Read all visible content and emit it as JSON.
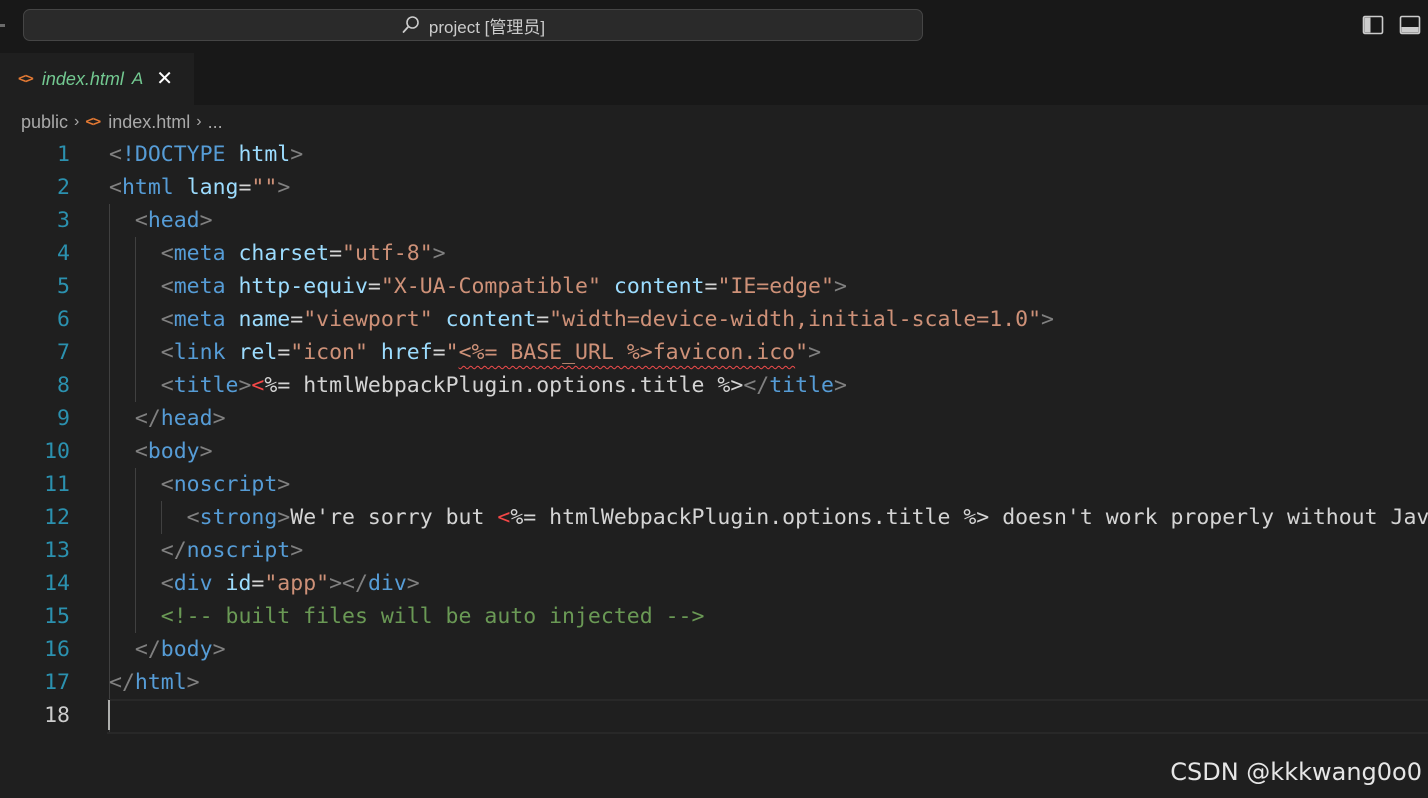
{
  "window": {
    "search_text": "project [管理员]"
  },
  "tab": {
    "filename": "index.html",
    "badge": "A",
    "close": "✕",
    "icon": "<>"
  },
  "breadcrumb": {
    "items": [
      "public",
      "index.html",
      "..."
    ],
    "separator": "›"
  },
  "editor": {
    "active_line": 18,
    "lines": [
      {
        "n": "1",
        "indent": 0,
        "tokens": [
          [
            "punc",
            "<"
          ],
          [
            "tag",
            "!DOCTYPE "
          ],
          [
            "attr",
            "html"
          ],
          [
            "punc",
            ">"
          ]
        ]
      },
      {
        "n": "2",
        "indent": 0,
        "tokens": [
          [
            "punc",
            "<"
          ],
          [
            "tag",
            "html "
          ],
          [
            "attr",
            "lang"
          ],
          [
            "plain",
            "="
          ],
          [
            "str",
            "\"\""
          ],
          [
            "punc",
            ">"
          ]
        ]
      },
      {
        "n": "3",
        "indent": 2,
        "tokens": [
          [
            "punc",
            "<"
          ],
          [
            "tag",
            "head"
          ],
          [
            "punc",
            ">"
          ]
        ]
      },
      {
        "n": "4",
        "indent": 4,
        "tokens": [
          [
            "punc",
            "<"
          ],
          [
            "tag",
            "meta "
          ],
          [
            "attr",
            "charset"
          ],
          [
            "plain",
            "="
          ],
          [
            "str",
            "\"utf-8\""
          ],
          [
            "punc",
            ">"
          ]
        ]
      },
      {
        "n": "5",
        "indent": 4,
        "tokens": [
          [
            "punc",
            "<"
          ],
          [
            "tag",
            "meta "
          ],
          [
            "attr",
            "http-equiv"
          ],
          [
            "plain",
            "="
          ],
          [
            "str",
            "\"X-UA-Compatible\" "
          ],
          [
            "attr",
            "content"
          ],
          [
            "plain",
            "="
          ],
          [
            "str",
            "\"IE=edge\""
          ],
          [
            "punc",
            ">"
          ]
        ]
      },
      {
        "n": "6",
        "indent": 4,
        "tokens": [
          [
            "punc",
            "<"
          ],
          [
            "tag",
            "meta "
          ],
          [
            "attr",
            "name"
          ],
          [
            "plain",
            "="
          ],
          [
            "str",
            "\"viewport\" "
          ],
          [
            "attr",
            "content"
          ],
          [
            "plain",
            "="
          ],
          [
            "str",
            "\"width=device-width,initial-scale=1.0\""
          ],
          [
            "punc",
            ">"
          ]
        ]
      },
      {
        "n": "7",
        "indent": 4,
        "tokens": [
          [
            "punc",
            "<"
          ],
          [
            "tag",
            "link "
          ],
          [
            "attr",
            "rel"
          ],
          [
            "plain",
            "="
          ],
          [
            "str",
            "\"icon\" "
          ],
          [
            "attr",
            "href"
          ],
          [
            "plain",
            "="
          ],
          [
            "str",
            "\""
          ],
          [
            "squig",
            "<%= BASE_URL %>favicon.ico"
          ],
          [
            "str",
            "\""
          ],
          [
            "punc",
            ">"
          ]
        ]
      },
      {
        "n": "8",
        "indent": 4,
        "tokens": [
          [
            "punc",
            "<"
          ],
          [
            "tag",
            "title"
          ],
          [
            "punc",
            ">"
          ],
          [
            "tplx",
            "<"
          ],
          [
            "tpl",
            "%= htmlWebpackPlugin.options.title %>"
          ],
          [
            "punc",
            "</"
          ],
          [
            "tag",
            "title"
          ],
          [
            "punc",
            ">"
          ]
        ]
      },
      {
        "n": "9",
        "indent": 2,
        "tokens": [
          [
            "punc",
            "</"
          ],
          [
            "tag",
            "head"
          ],
          [
            "punc",
            ">"
          ]
        ]
      },
      {
        "n": "10",
        "indent": 2,
        "tokens": [
          [
            "punc",
            "<"
          ],
          [
            "tag",
            "body"
          ],
          [
            "punc",
            ">"
          ]
        ]
      },
      {
        "n": "11",
        "indent": 4,
        "tokens": [
          [
            "punc",
            "<"
          ],
          [
            "tag",
            "noscript"
          ],
          [
            "punc",
            ">"
          ]
        ]
      },
      {
        "n": "12",
        "indent": 6,
        "tokens": [
          [
            "punc",
            "<"
          ],
          [
            "tag",
            "strong"
          ],
          [
            "punc",
            ">"
          ],
          [
            "plain",
            "We're sorry but "
          ],
          [
            "tplx",
            "<"
          ],
          [
            "tpl",
            "%= htmlWebpackPlugin.options.title %> doesn't work properly without JavaScript enabled. Please enable it to continue."
          ]
        ]
      },
      {
        "n": "13",
        "indent": 4,
        "tokens": [
          [
            "punc",
            "</"
          ],
          [
            "tag",
            "noscript"
          ],
          [
            "punc",
            ">"
          ]
        ]
      },
      {
        "n": "14",
        "indent": 4,
        "tokens": [
          [
            "punc",
            "<"
          ],
          [
            "tag",
            "div "
          ],
          [
            "attr",
            "id"
          ],
          [
            "plain",
            "="
          ],
          [
            "str",
            "\"app\""
          ],
          [
            "punc",
            "></"
          ],
          [
            "tag",
            "div"
          ],
          [
            "punc",
            ">"
          ]
        ]
      },
      {
        "n": "15",
        "indent": 4,
        "tokens": [
          [
            "com",
            "<!-- built files will be auto injected -->"
          ]
        ]
      },
      {
        "n": "16",
        "indent": 2,
        "tokens": [
          [
            "punc",
            "</"
          ],
          [
            "tag",
            "body"
          ],
          [
            "punc",
            ">"
          ]
        ]
      },
      {
        "n": "17",
        "indent": 0,
        "tokens": [
          [
            "punc",
            "</"
          ],
          [
            "tag",
            "html"
          ],
          [
            "punc",
            ">"
          ]
        ]
      },
      {
        "n": "18",
        "indent": 0,
        "tokens": []
      }
    ]
  },
  "watermark": "CSDN @kkkwang0o0",
  "colors": {
    "background": "#1f1f1f",
    "tag": "#569cd6",
    "attribute": "#9cdcfe",
    "string": "#ce9178",
    "comment": "#6a9955",
    "line_number": "#2b91af",
    "modified_badge": "#73c991",
    "file_icon": "#e37933"
  }
}
